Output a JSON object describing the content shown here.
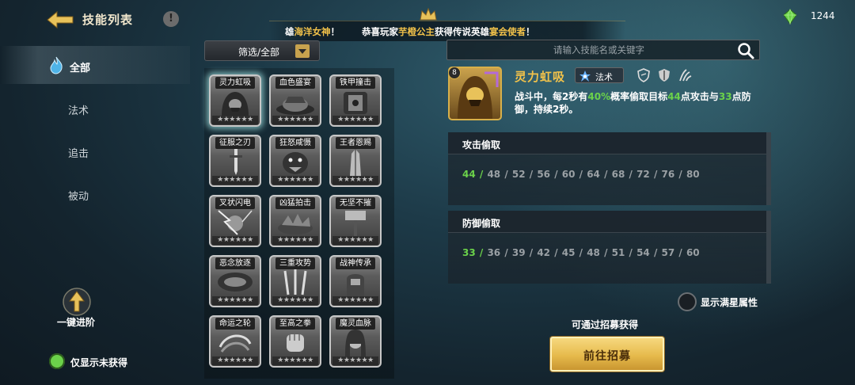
{
  "header": {
    "title": "技能列表",
    "info_label": "!",
    "marquee": {
      "prefix1": "雄",
      "hero1": "海洋女神",
      "suffix1": "！",
      "prefix2": "恭喜玩家",
      "player": "芋橙公主",
      "mid2": "获得传说英雄",
      "hero2": "宴会使者",
      "suffix2": "！"
    },
    "gem_count": "1244"
  },
  "sidebar": {
    "items": [
      {
        "label": "全部",
        "active": true
      },
      {
        "label": "法术",
        "active": false
      },
      {
        "label": "追击",
        "active": false
      },
      {
        "label": "被动",
        "active": false
      }
    ],
    "advance_label": "一键进阶",
    "unowned_toggle_label": "仅显示未获得"
  },
  "filter": {
    "label": "筛选/全部"
  },
  "search": {
    "placeholder": "请输入技能名或关键字"
  },
  "skills": [
    {
      "name": "灵力虹吸",
      "stars": "★★★★★★",
      "selected": true
    },
    {
      "name": "血色盛宴",
      "stars": "★★★★★★"
    },
    {
      "name": "铁甲撞击",
      "stars": "★★★★★★"
    },
    {
      "name": "征服之刃",
      "stars": "★★★★★★"
    },
    {
      "name": "狂怒咸慑",
      "stars": "★★★★★★"
    },
    {
      "name": "王者恩赐",
      "stars": "★★★★★★"
    },
    {
      "name": "叉状闪电",
      "stars": "★★★★★★"
    },
    {
      "name": "凶猛拍击",
      "stars": "★★★★★★"
    },
    {
      "name": "无坚不摧",
      "stars": "★★★★★★"
    },
    {
      "name": "恶念放逐",
      "stars": "★★★★★★"
    },
    {
      "name": "三重攻势",
      "stars": "★★★★★★"
    },
    {
      "name": "战神传承",
      "stars": "★★★★★★"
    },
    {
      "name": "命运之轮",
      "stars": "★★★★★★"
    },
    {
      "name": "至高之拳",
      "stars": "★★★★★★"
    },
    {
      "name": "魔灵血脉",
      "stars": "★★★★★★"
    }
  ],
  "detail": {
    "level": "8",
    "name": "灵力虹吸",
    "type_label": "法术",
    "desc": {
      "p1": "战斗中，每",
      "v1": "2",
      "p2": "秒有",
      "v2": "40%",
      "p3": "概率偷取目标",
      "v3": "44",
      "p4": "点攻击与",
      "v4": "33",
      "p5": "点防御，持续",
      "v5": "2",
      "p6": "秒。"
    },
    "attr_icons": [
      "shield-icon",
      "armor-icon",
      "claw-icon"
    ]
  },
  "stats": [
    {
      "title": "攻击偷取",
      "current": "44 /",
      "rest": "48 / 52 / 56 / 60 / 64 / 68 / 72 / 76 / 80"
    },
    {
      "title": "防御偷取",
      "current": "33 /",
      "rest": "36 / 39 / 42 / 45 / 48 / 51 / 54 / 57 / 60"
    }
  ],
  "max_star_label": "显示满星属性",
  "recruit": {
    "hint": "可通过招募获得",
    "button_label": "前往招募"
  },
  "colors": {
    "accent_gold": "#f2c24a",
    "accent_green": "#6bd24a"
  }
}
